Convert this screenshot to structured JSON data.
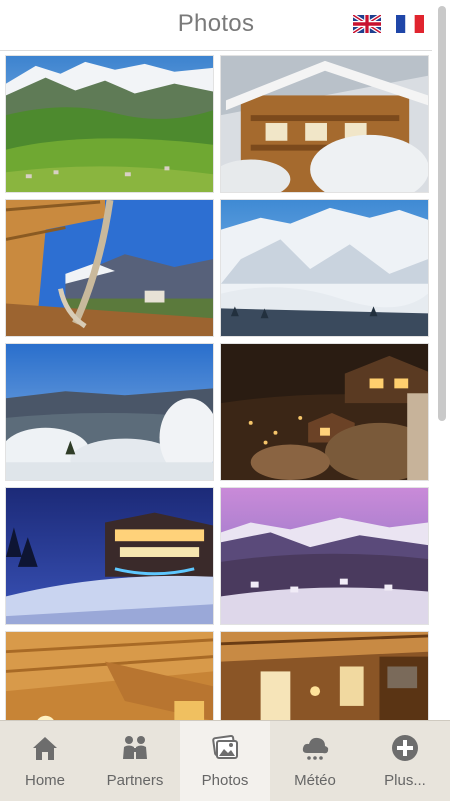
{
  "header": {
    "title": "Photos",
    "languages": [
      {
        "code": "en",
        "icon": "uk-flag-icon"
      },
      {
        "code": "fr",
        "icon": "france-flag-icon"
      }
    ]
  },
  "gallery": {
    "photos": [
      {
        "subject": "alpine-valley-summer"
      },
      {
        "subject": "chalet-snow-facade"
      },
      {
        "subject": "hammock-balcony-view"
      },
      {
        "subject": "snowy-mountain-peaks"
      },
      {
        "subject": "winter-frost-valley"
      },
      {
        "subject": "chalet-night-lights"
      },
      {
        "subject": "chalet-blue-dusk"
      },
      {
        "subject": "village-pink-sky"
      },
      {
        "subject": "chalet-interior-living"
      },
      {
        "subject": "chalet-interior-dining"
      }
    ]
  },
  "tabbar": {
    "tabs": [
      {
        "label": "Home",
        "icon": "home-icon",
        "active": false
      },
      {
        "label": "Partners",
        "icon": "partners-icon",
        "active": false
      },
      {
        "label": "Photos",
        "icon": "photos-icon",
        "active": true
      },
      {
        "label": "Météo",
        "icon": "weather-icon",
        "active": false
      },
      {
        "label": "Plus...",
        "icon": "plus-icon",
        "active": false
      }
    ]
  },
  "colors": {
    "header_title": "#7a7a7a",
    "tabbar_bg": "#e8e4dc",
    "tab_active_bg": "#f3f1ed"
  }
}
